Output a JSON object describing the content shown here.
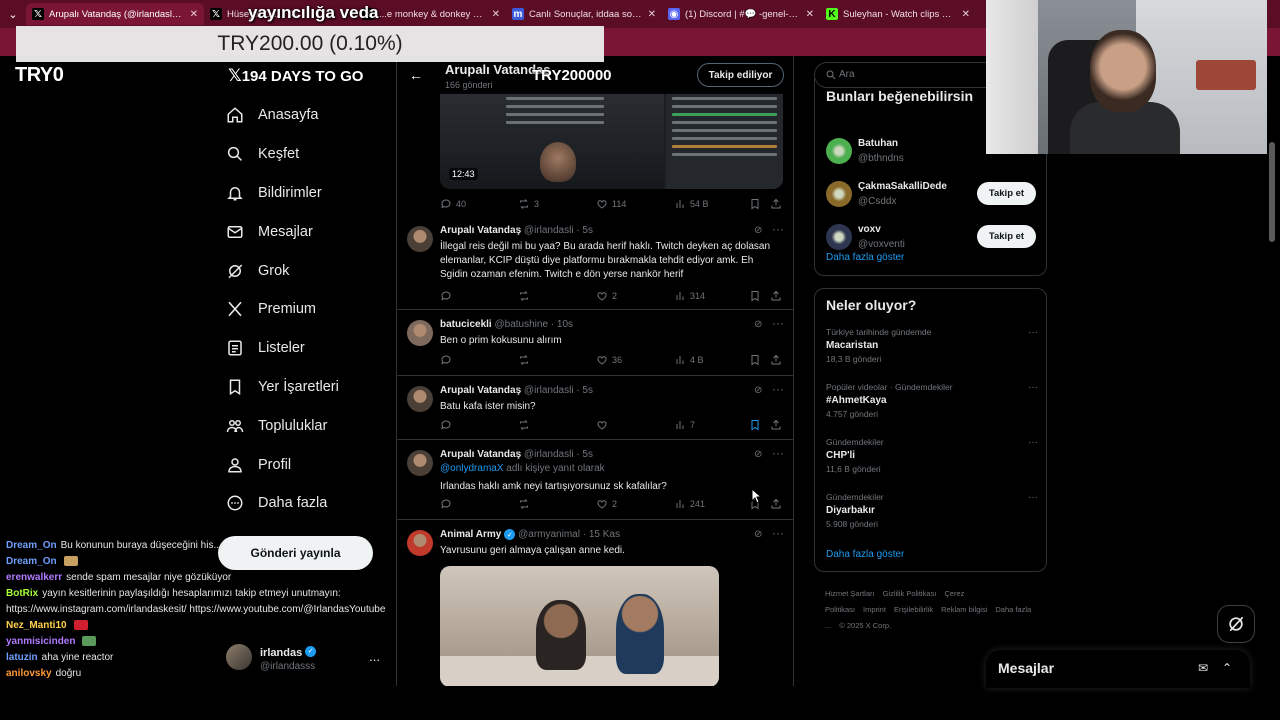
{
  "browser": {
    "tabs": [
      {
        "label": "Arupalı Vatandaş (@irlandasll) ...",
        "favicon": "x-icon",
        "active": true
      },
      {
        "label": "Hüseyin Ca...",
        "favicon": "x-icon",
        "active": false
      },
      {
        "label": "...e monkey & donkey 🎙 : \"@...",
        "favicon": "x-icon",
        "active": false
      },
      {
        "label": "Canlı Sonuçlar, iddaa sonuçları...",
        "favicon": "m-icon",
        "active": false
      },
      {
        "label": "(1) Discord | #💬 -genel-sohbet...",
        "favicon": "discord-icon",
        "active": false
      },
      {
        "label": "Suleyhan - Watch clips on Kick",
        "favicon": "kick-icon",
        "active": false
      }
    ]
  },
  "overlay": {
    "banner": "yayıncılığa veda",
    "donation_text": "TRY200.00 (0.10%)",
    "goal_left": "TRY0",
    "countdown": "194 DAYS TO GO",
    "goal_right": "TRY200000"
  },
  "sidebar": {
    "items": [
      {
        "label": "Anasayfa",
        "icon": "home-icon"
      },
      {
        "label": "Keşfet",
        "icon": "search-icon"
      },
      {
        "label": "Bildirimler",
        "icon": "bell-icon"
      },
      {
        "label": "Mesajlar",
        "icon": "mail-icon"
      },
      {
        "label": "Grok",
        "icon": "grok-icon"
      },
      {
        "label": "Premium",
        "icon": "x-logo-icon"
      },
      {
        "label": "Listeler",
        "icon": "list-icon"
      },
      {
        "label": "Yer İşaretleri",
        "icon": "bookmark-icon"
      },
      {
        "label": "Topluluklar",
        "icon": "communities-icon"
      },
      {
        "label": "Profil",
        "icon": "person-icon"
      },
      {
        "label": "Daha fazla",
        "icon": "more-circle-icon"
      }
    ],
    "post_button": "Gönderi yayınla",
    "account": {
      "name": "irlandas",
      "handle": "@irlandasss",
      "more": "..."
    }
  },
  "chat": [
    {
      "user": "Dream_On",
      "color": "#6f9fff",
      "text": "Bu konunun buraya düşeceğini his...",
      "emote": null
    },
    {
      "user": "Dream_On",
      "color": "#6f9fff",
      "text": "",
      "emote": "#c8a060"
    },
    {
      "user": "erenwalkerr",
      "color": "#b07bff",
      "text": "sende spam mesajlar niye gözüküyor",
      "emote": null
    },
    {
      "user": "BotRix",
      "color": "#a6ff3b",
      "text": "yayın kesitlerinin paylaşıldığı hesaplarımızı takip etmeyi unutmayın:",
      "emote": null
    },
    {
      "user": "",
      "color": "#e6e6e6",
      "text": "https://www.instagram.com/irlandaskesit/ https://www.youtube.com/@IrlandasYoutube",
      "emote": null
    },
    {
      "user": "Nez_Manti10",
      "color": "#ffd24a",
      "text": "",
      "emote": "#d02030"
    },
    {
      "user": "yanmisicinden",
      "color": "#b07bff",
      "text": "",
      "emote": "#5a9a5a"
    },
    {
      "user": "latuzin",
      "color": "#6f9fff",
      "text": "aha yine reactor",
      "emote": null
    },
    {
      "user": "anilovsky",
      "color": "#ff9a3b",
      "text": "doğru",
      "emote": null
    }
  ],
  "feed": {
    "header": {
      "name": "Arupalı Vatandaş",
      "count": "166 gönderi",
      "follow_label": "Takip ediliyor"
    },
    "media_duration": "12:43",
    "first_actions": {
      "replies": "40",
      "reposts": "3",
      "likes": "114",
      "views": "54 B"
    },
    "tweets": [
      {
        "name": "Arupalı Vatandaş",
        "handle": "@irlandasli · 5s",
        "reply_to": "",
        "reply_suffix": "",
        "text": "İllegal reis değil mi bu yaa? Bu arada herif haklı. Twitch deyken aç dolasan elemanlar, KCIP düştü diye platformu bırakmakla tehdit ediyor amk. Eh Sgidin ozaman efenim. Twitch e dön yerse nankör herif",
        "replies": "",
        "reposts": "",
        "likes": "2",
        "views": "314",
        "avatar": "#4a4038"
      },
      {
        "name": "batucicekli",
        "handle": "@batushine · 10s",
        "reply_to": "",
        "reply_suffix": "",
        "text": "Ben o prim kokusunu alırım",
        "replies": "",
        "reposts": "",
        "likes": "36",
        "views": "4 B",
        "avatar": "#7d6a5c"
      },
      {
        "name": "Arupalı Vatandaş",
        "handle": "@irlandasli · 5s",
        "reply_to": "",
        "reply_suffix": "",
        "text": "Batu kafa ister misin?",
        "replies": "",
        "reposts": "",
        "likes": "",
        "views": "7",
        "avatar": "#4a4038"
      },
      {
        "name": "Arupalı Vatandaş",
        "handle": "@irlandasli · 5s",
        "reply_to": "@onlydramaX",
        "reply_suffix": " adlı kişiye yanıt olarak",
        "text": "Irlandas haklı amk neyi tartışıyorsunuz sk kafalılar?",
        "replies": "",
        "reposts": "",
        "likes": "2",
        "views": "241",
        "avatar": "#4a4038"
      },
      {
        "name": "Animal Army",
        "handle": "@armyanimal · 15 Kas",
        "reply_to": "",
        "reply_suffix": "",
        "text": "Yavrusunu geri almaya çalışan anne kedi.",
        "replies": "",
        "reposts": "",
        "likes": "",
        "views": "",
        "avatar": "#c0392b"
      }
    ]
  },
  "right": {
    "search_placeholder": "Ara",
    "who_title": "Bunları beğenebilirsin",
    "who": [
      {
        "name": "Batuhan",
        "handle": "@bthndns",
        "button": "",
        "avatar": "#4caf50"
      },
      {
        "name": "ÇakmaSakalliDede",
        "handle": "@Csddx",
        "button": "Takip et",
        "avatar": "#8a6a2a"
      },
      {
        "name": "voxv",
        "handle": "@voxventi",
        "button": "Takip et",
        "avatar": "#2d3550"
      }
    ],
    "who_more": "Daha fazla göster",
    "trends_title": "Neler oluyor?",
    "trends": [
      {
        "context": "Türkiye tarihinde gündemde",
        "name": "Macaristan",
        "posts": "18,3 B gönderi"
      },
      {
        "context": "Popüler videolar · Gündemdekiler",
        "name": "#AhmetKaya",
        "posts": "4.757 gönderi"
      },
      {
        "context": "Gündemdekiler",
        "name": "CHP'li",
        "posts": "11,6 B gönderi"
      },
      {
        "context": "Gündemdekiler",
        "name": "Diyarbakır",
        "posts": "5.908 gönderi"
      }
    ],
    "trends_more": "Daha fazla göster",
    "footer": [
      "Hizmet Şartları",
      "Gizlilik Politikası",
      "Çerez Politikası",
      "Imprint",
      "Erişilebilirlik",
      "Reklam bilgisi",
      "Daha fazla ...",
      "© 2025 X Corp."
    ]
  },
  "messages_drawer": {
    "title": "Mesajlar"
  }
}
